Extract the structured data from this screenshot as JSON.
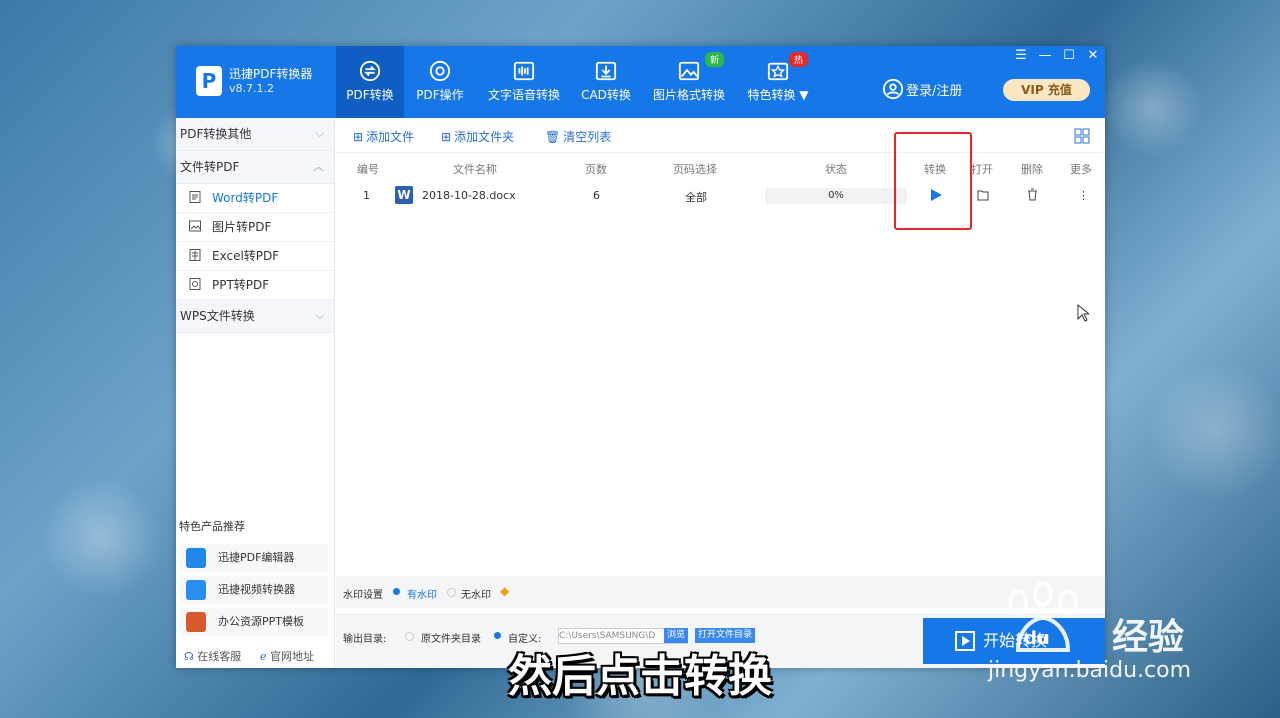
{
  "app": {
    "name": "迅捷PDF转换器",
    "version": "v8.7.1.2"
  },
  "nav": [
    {
      "label": "PDF转换",
      "icon": "convert-icon",
      "active": true
    },
    {
      "label": "PDF操作",
      "icon": "settings-icon"
    },
    {
      "label": "文字语音转换",
      "icon": "audio-wave-icon"
    },
    {
      "label": "CAD转换",
      "icon": "cad-icon"
    },
    {
      "label": "图片格式转换",
      "icon": "image-icon",
      "badge": "新",
      "badge_color": "#2cb94a"
    },
    {
      "label": "特色转换",
      "icon": "star-box-icon",
      "badge": "热",
      "badge_color": "#e62a2a"
    }
  ],
  "header": {
    "login": "登录/注册",
    "vip_label": "VIP",
    "vip_action": "充值"
  },
  "sidebar": {
    "groups": [
      {
        "label": "PDF转换其他"
      },
      {
        "label": "文件转PDF",
        "items": [
          "Word转PDF",
          "图片转PDF",
          "Excel转PDF",
          "PPT转PDF"
        ]
      },
      {
        "label": "WPS文件转换"
      }
    ],
    "rec_title": "特色产品推荐",
    "recommendations": [
      "迅捷PDF编辑器",
      "迅捷视频转换器",
      "办公资源PPT模板"
    ],
    "footer": {
      "service": "在线客服",
      "website": "官网地址"
    }
  },
  "toolbar": {
    "add_file": "添加文件",
    "add_folder": "添加文件夹",
    "clear": "清空列表"
  },
  "table": {
    "headers": [
      "编号",
      "文件名称",
      "页数",
      "页码选择",
      "状态",
      "转换",
      "打开",
      "删除",
      "更多"
    ],
    "rows": [
      {
        "index": "1",
        "name": "2018-10-28.docx",
        "pages": "6",
        "range": "全部",
        "status": "0%",
        "progress": 0
      }
    ]
  },
  "watermark": {
    "label": "水印设置",
    "opt_on": "有水印",
    "opt_off": "无水印"
  },
  "output": {
    "label": "输出目录:",
    "opt_original": "原文件夹目录",
    "opt_custom": "自定义:",
    "path": "C:\\Users\\SAMSUNG\\D",
    "browse": "浏览",
    "open_dir": "打开文件目录",
    "start": "开始转换"
  },
  "caption": "然后点击转换",
  "watermark_logo": {
    "brand": "经验",
    "url": "jingyan.baidu.com"
  },
  "colors": {
    "primary": "#1677e8",
    "highlight": "#e4252b"
  }
}
